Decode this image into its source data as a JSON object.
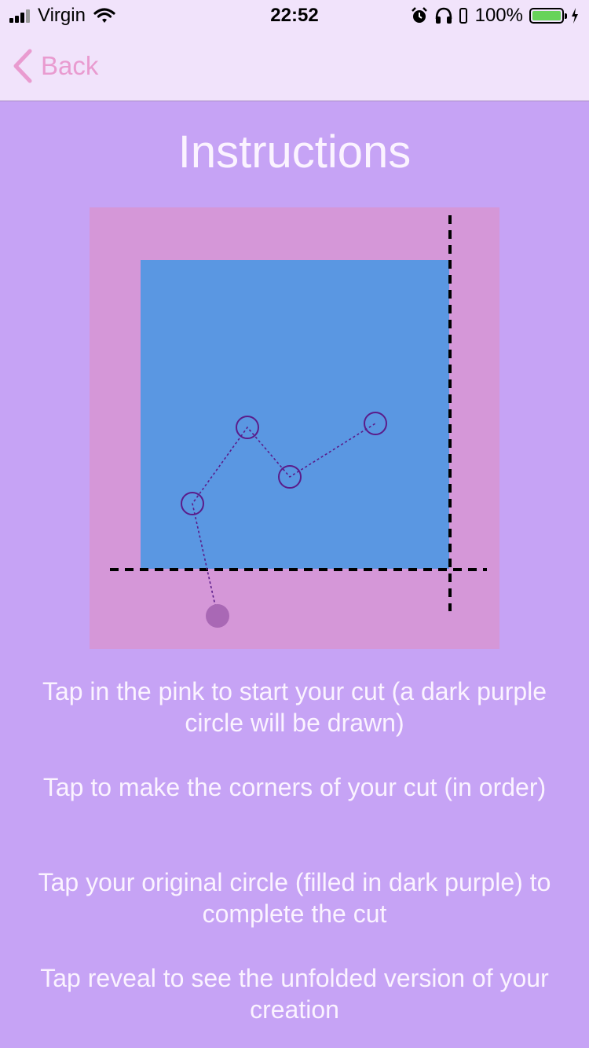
{
  "status_bar": {
    "carrier": "Virgin",
    "time": "22:52",
    "battery_percent": "100%",
    "battery_level": 1.0,
    "icons": [
      "signal-icon",
      "wifi-icon",
      "alarm-icon",
      "headphones-icon",
      "battery-icon",
      "charging-icon"
    ]
  },
  "nav": {
    "back_label": "Back",
    "back_icon": "chevron-left-icon",
    "accent_color": "#e99bd0"
  },
  "page": {
    "title": "Instructions"
  },
  "diagram": {
    "colors": {
      "paper": "#d597d8",
      "folded_square": "#5a97e2",
      "cut_line": "#5a1c8a",
      "start_circle": "#a968b5",
      "fold_line": "#000000"
    }
  },
  "instructions": [
    "Tap in the pink to start your cut (a dark purple circle will be drawn)",
    "Tap to make the corners of your cut (in order)",
    "Tap your original circle (filled in dark purple) to complete the cut",
    "Tap reveal to see the unfolded version of your creation"
  ]
}
